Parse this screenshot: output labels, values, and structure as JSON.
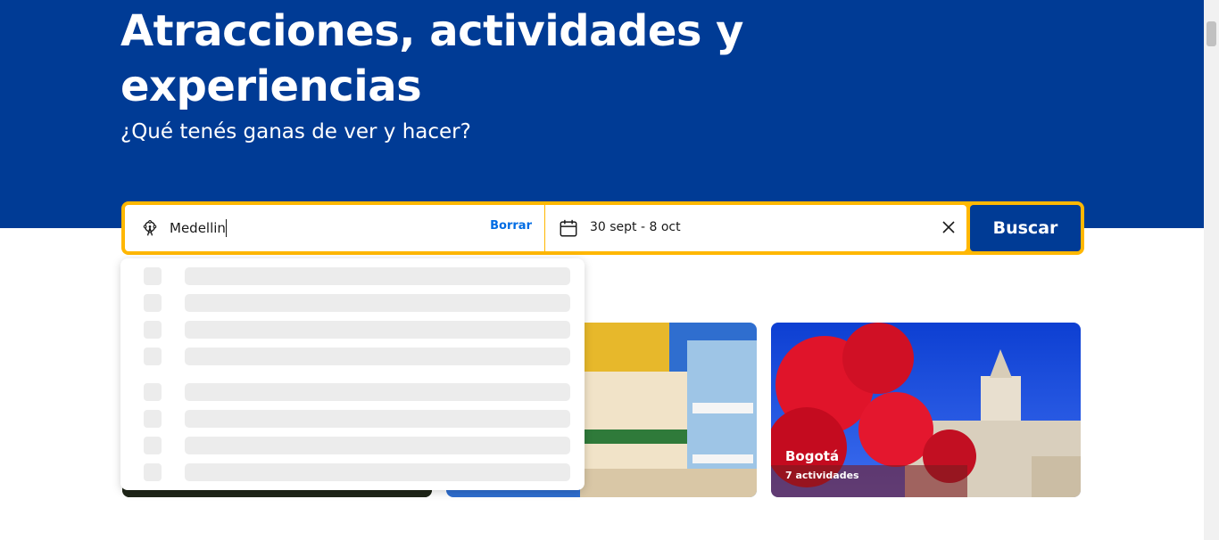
{
  "hero": {
    "title": "Atracciones, actividades y experiencias",
    "subtitle": "¿Qué tenés ganas de ver y hacer?"
  },
  "search": {
    "destination_value": "Medellin",
    "clear_label": "Borrar",
    "dates": "30 sept - 8 oct",
    "button_label": "Buscar",
    "icons": {
      "destination": "ferris-wheel-icon",
      "dates": "calendar-icon",
      "clear_dates": "close-icon"
    }
  },
  "dropdown": {
    "state": "loading",
    "skeleton_rows": 8
  },
  "cards": [
    {
      "name": "",
      "count": ""
    },
    {
      "name": "",
      "count": ""
    },
    {
      "name": "Bogotá",
      "count": "7 actividades"
    }
  ],
  "colors": {
    "brand_blue": "#003b95",
    "accent_yellow": "#ffb700",
    "link_blue": "#006ce4",
    "skeleton": "#ececec"
  }
}
